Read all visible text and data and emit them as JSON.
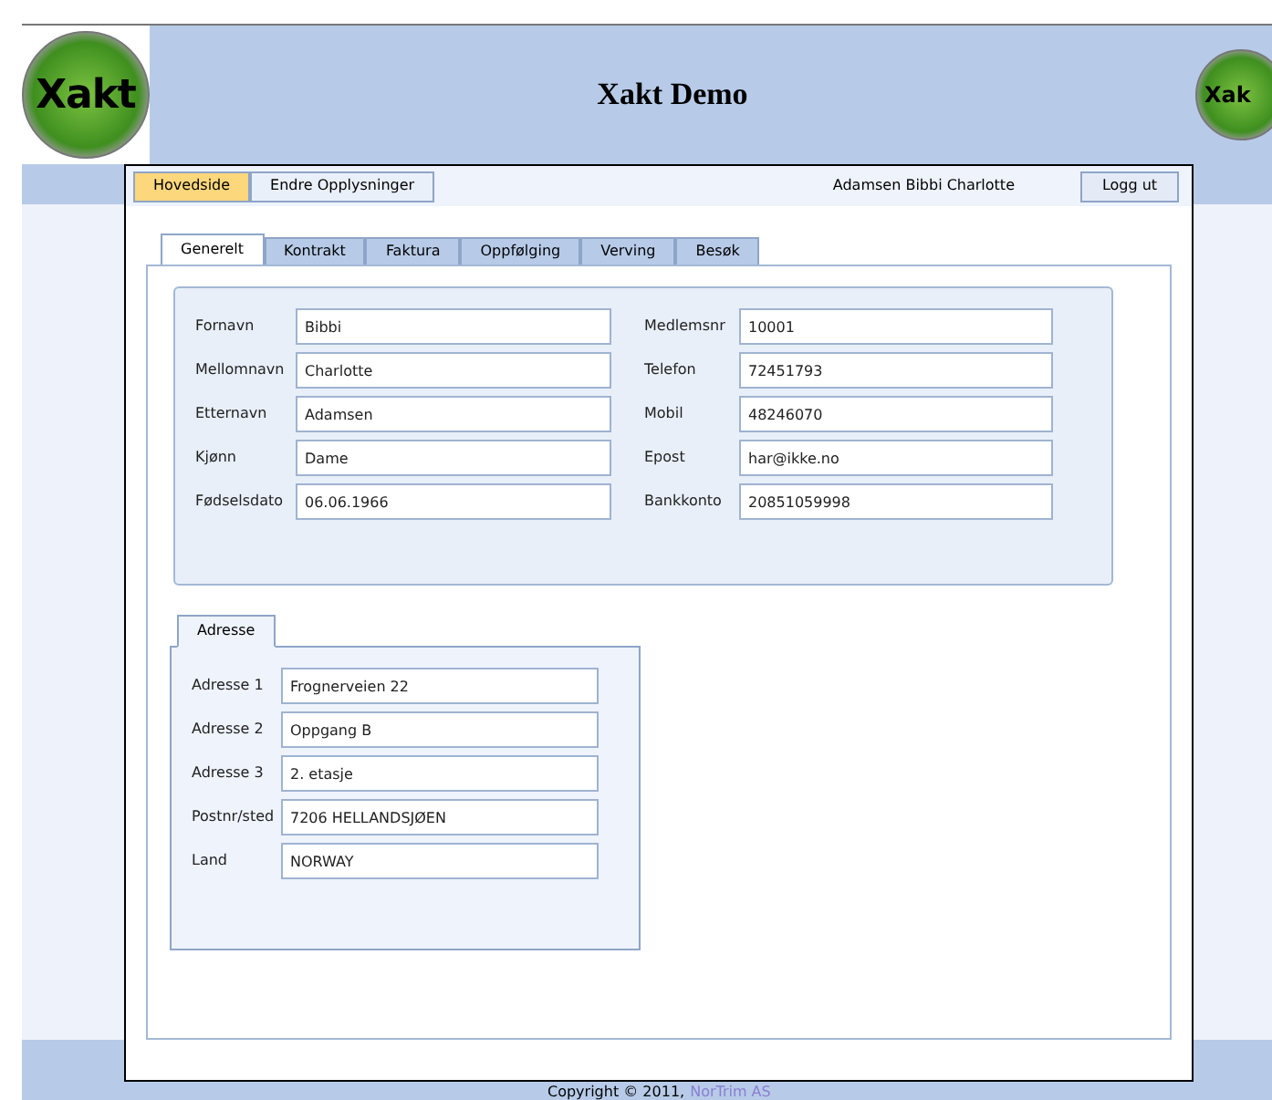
{
  "header": {
    "title": "Xakt Demo",
    "logo_text": "Xakt",
    "right_logo_text": "Xak"
  },
  "nav": {
    "buttons": [
      {
        "label": "Hovedside",
        "selected": true
      },
      {
        "label": "Endre Opplysninger",
        "selected": false
      }
    ],
    "user": "Adamsen Bibbi Charlotte",
    "logout": "Logg ut"
  },
  "tabs": [
    {
      "label": "Generelt",
      "selected": true
    },
    {
      "label": "Kontrakt",
      "selected": false
    },
    {
      "label": "Faktura",
      "selected": false
    },
    {
      "label": "Oppfølging",
      "selected": false
    },
    {
      "label": "Verving",
      "selected": false
    },
    {
      "label": "Besøk",
      "selected": false
    }
  ],
  "left_fields": [
    {
      "label": "Fornavn",
      "value": "Bibbi"
    },
    {
      "label": "Mellomnavn",
      "value": "Charlotte"
    },
    {
      "label": "Etternavn",
      "value": "Adamsen"
    },
    {
      "label": "Kjønn",
      "value": "Dame"
    },
    {
      "label": "Fødselsdato",
      "value": "06.06.1966"
    }
  ],
  "right_fields": [
    {
      "label": "Medlemsnr",
      "value": "10001"
    },
    {
      "label": "Telefon",
      "value": "72451793"
    },
    {
      "label": "Mobil",
      "value": "48246070"
    },
    {
      "label": "Epost",
      "value": "har@ikke.no"
    },
    {
      "label": "Bankkonto",
      "value": "20851059998"
    }
  ],
  "address": {
    "tab": "Adresse",
    "fields": [
      {
        "label": "Adresse 1",
        "value": "Frognerveien 22"
      },
      {
        "label": "Adresse 2",
        "value": "Oppgang B"
      },
      {
        "label": "Adresse 3",
        "value": "2. etasje"
      },
      {
        "label": "Postnr/sted",
        "value": "7206 HELLANDSJØEN"
      },
      {
        "label": "Land",
        "value": "NORWAY"
      }
    ]
  },
  "footer": {
    "text": "Copyright © 2011,",
    "link": "NorTrim AS"
  }
}
